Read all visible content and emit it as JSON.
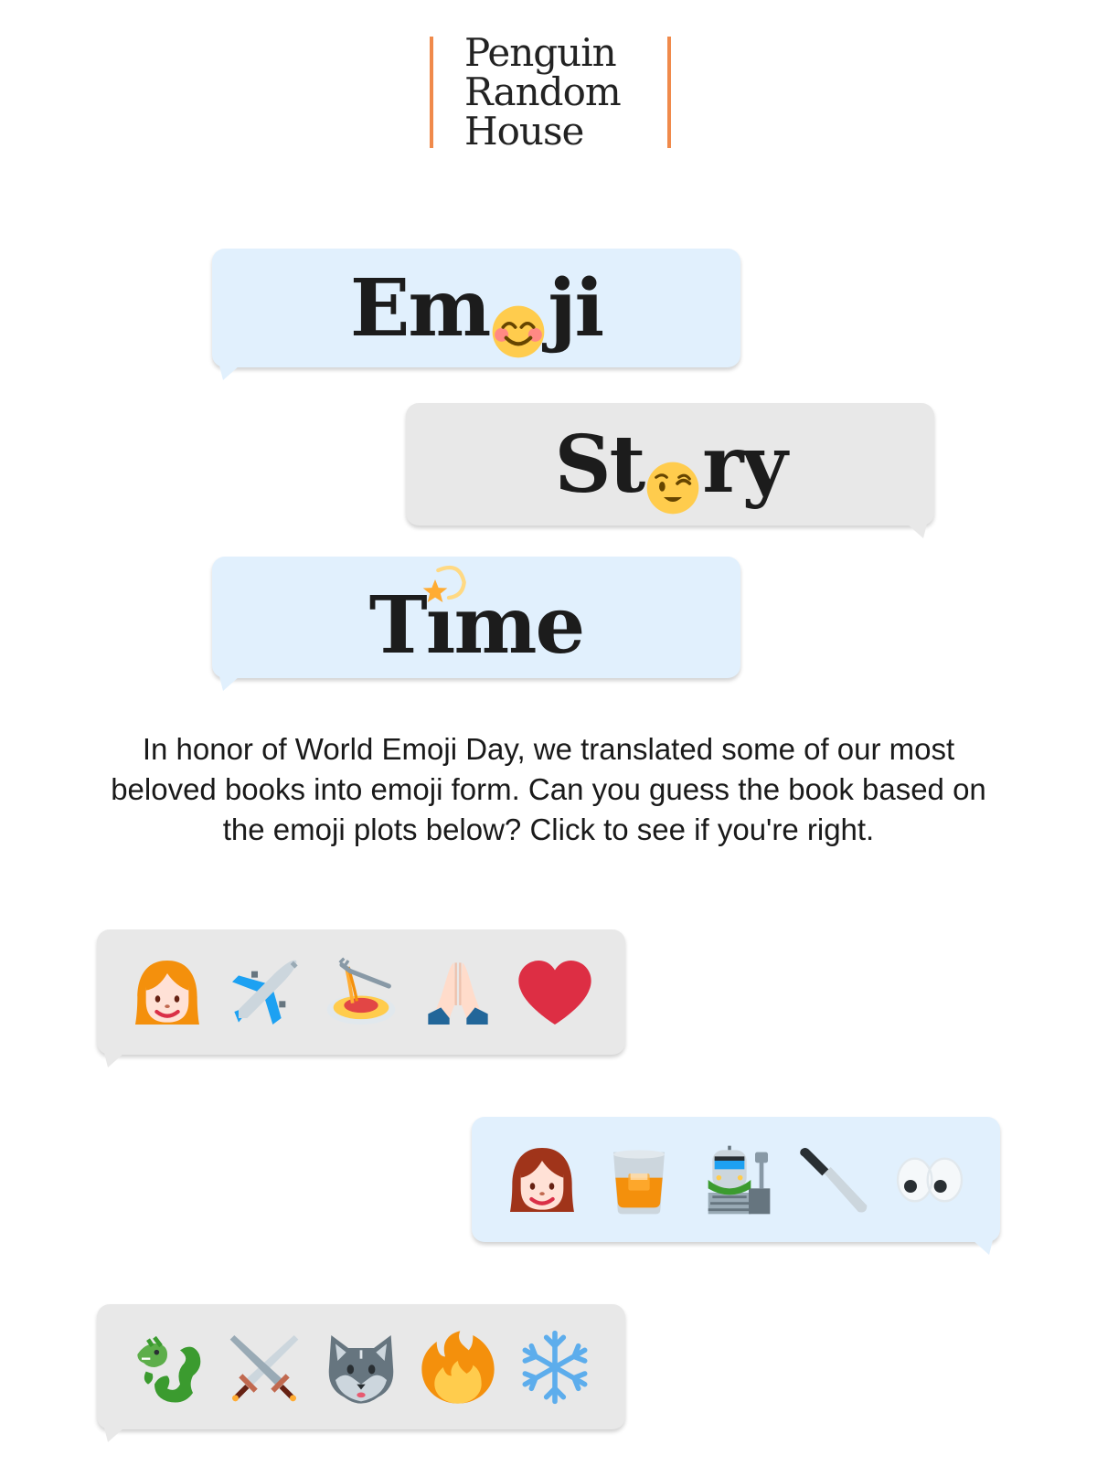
{
  "logo": {
    "lines": [
      "Penguin",
      "Random",
      "House"
    ],
    "accent_color": "#f08a4b"
  },
  "title": {
    "words": [
      {
        "before": "Em",
        "emoji": "smiling-face-with-smiling-eyes",
        "after": "ji",
        "bubble_color": "#e1f0fd"
      },
      {
        "before": "St",
        "emoji": "winking-face",
        "after": "ry",
        "bubble_color": "#e8e8e8"
      },
      {
        "before": "T",
        "emoji": "dizzy-star",
        "after": "me",
        "bubble_color": "#e1f0fd"
      }
    ]
  },
  "intro": {
    "lines": [
      "In honor of World Emoji Day, we translated some of our most",
      "beloved books into emoji form. Can you guess the book based on",
      "the emoji plots below? Click to see if you're right."
    ]
  },
  "puzzles": [
    {
      "side": "left",
      "bubble_color": "#e8e8e8",
      "emojis": [
        "woman-blond",
        "airplane",
        "spaghetti",
        "folded-hands",
        "red-heart"
      ]
    },
    {
      "side": "right",
      "bubble_color": "#e1f0fd",
      "emojis": [
        "woman-red-hair",
        "tumbler-glass",
        "train-station",
        "kitchen-knife",
        "eyes"
      ]
    },
    {
      "side": "left",
      "bubble_color": "#e8e8e8",
      "emojis": [
        "dragon",
        "crossed-swords",
        "wolf",
        "fire",
        "snowflake"
      ]
    }
  ]
}
